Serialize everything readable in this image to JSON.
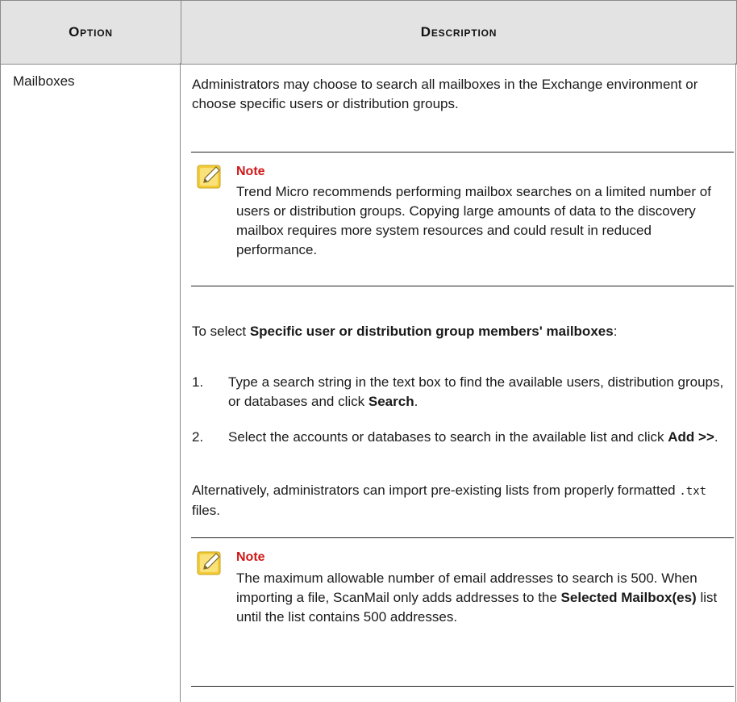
{
  "table": {
    "headers": {
      "option": "Option",
      "description": "Description"
    },
    "row": {
      "option": "Mailboxes",
      "intro": "Administrators may choose to search all mailboxes in the Exchange environment or choose specific users or distribution groups.",
      "note1": {
        "title": "Note",
        "body": "Trend Micro recommends performing mailbox searches on a limited number of users or distribution groups. Copying large amounts of data to the discovery mailbox requires more system resources and could result in reduced performance."
      },
      "select_prefix": "To select ",
      "select_bold": "Specific user or distribution group members' mailboxes",
      "select_suffix": ":",
      "steps": [
        {
          "num": "1.",
          "text": "Type a search string in the text box to find the available users, distribution groups, or databases and click ",
          "bold": "Search",
          "end": "."
        },
        {
          "num": "2.",
          "text": "Select the accounts or databases to search in the available list and click ",
          "bold": "Add >>",
          "end": "."
        }
      ],
      "alt_prefix": "Alternatively, administrators can import pre-existing lists from properly formatted ",
      "alt_code": ".txt",
      "alt_suffix": " files.",
      "note2": {
        "title": "Note",
        "body_prefix": "The maximum allowable number of email addresses to search is 500. When importing a file, ScanMail only adds addresses to the ",
        "body_bold": "Selected Mailbox(es)",
        "body_suffix": " list until the list contains 500 addresses."
      }
    }
  },
  "colors": {
    "note_title": "#d01818",
    "header_bg": "#e3e3e3",
    "note_icon": "#f0c419"
  }
}
